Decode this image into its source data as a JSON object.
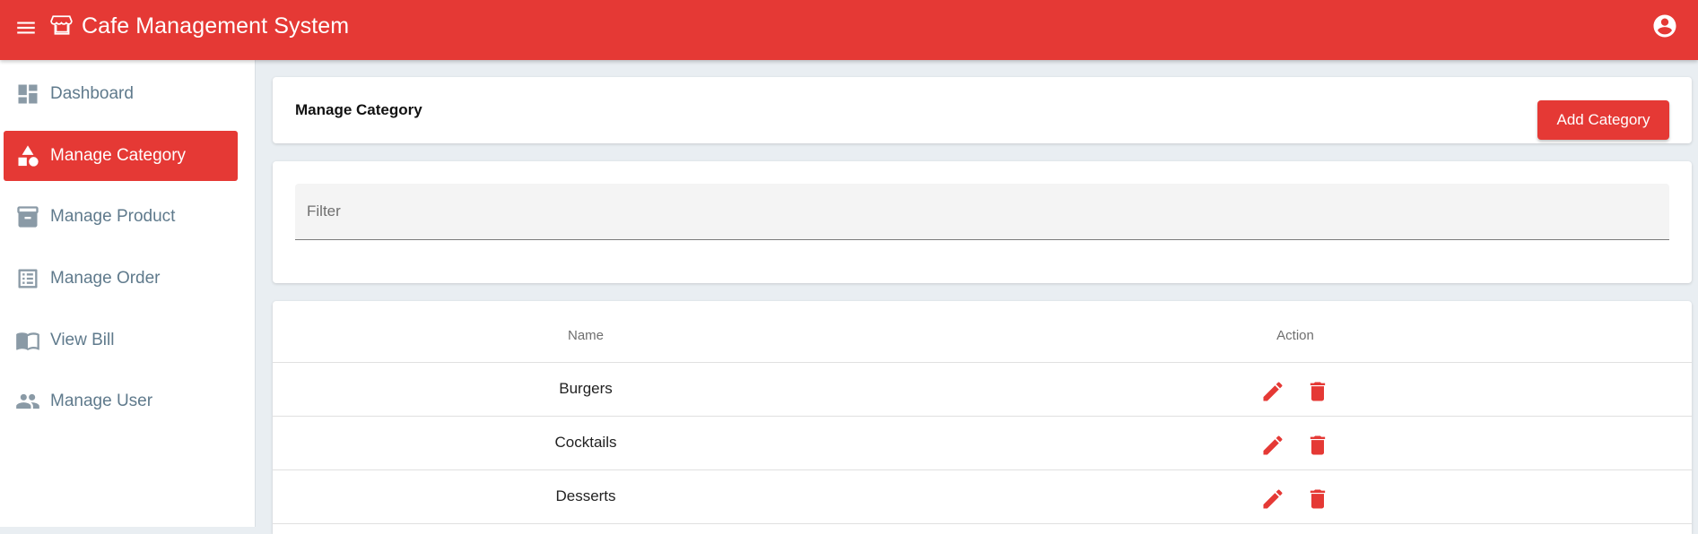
{
  "app": {
    "title": "Cafe Management System",
    "brand_color": "#e53935",
    "icons": {
      "menu": "menu-icon",
      "store": "store-icon",
      "account": "account-circle-icon"
    }
  },
  "sidebar": {
    "items": [
      {
        "label": "Dashboard",
        "icon": "dashboard-icon",
        "active": false
      },
      {
        "label": "Manage Category",
        "icon": "category-icon",
        "active": true
      },
      {
        "label": "Manage Product",
        "icon": "inventory-icon",
        "active": false
      },
      {
        "label": "Manage Order",
        "icon": "list-icon",
        "active": false
      },
      {
        "label": "View Bill",
        "icon": "book-icon",
        "active": false
      },
      {
        "label": "Manage User",
        "icon": "people-icon",
        "active": false
      }
    ]
  },
  "page": {
    "title": "Manage Category",
    "add_button_label": "Add Category"
  },
  "filter": {
    "placeholder": "Filter",
    "value": ""
  },
  "table": {
    "columns": [
      "Name",
      "Action"
    ],
    "rows": [
      {
        "name": "Burgers",
        "actions": [
          "edit-icon",
          "delete-icon"
        ]
      },
      {
        "name": "Cocktails",
        "actions": [
          "edit-icon",
          "delete-icon"
        ]
      },
      {
        "name": "Desserts",
        "actions": [
          "edit-icon",
          "delete-icon"
        ]
      }
    ]
  }
}
